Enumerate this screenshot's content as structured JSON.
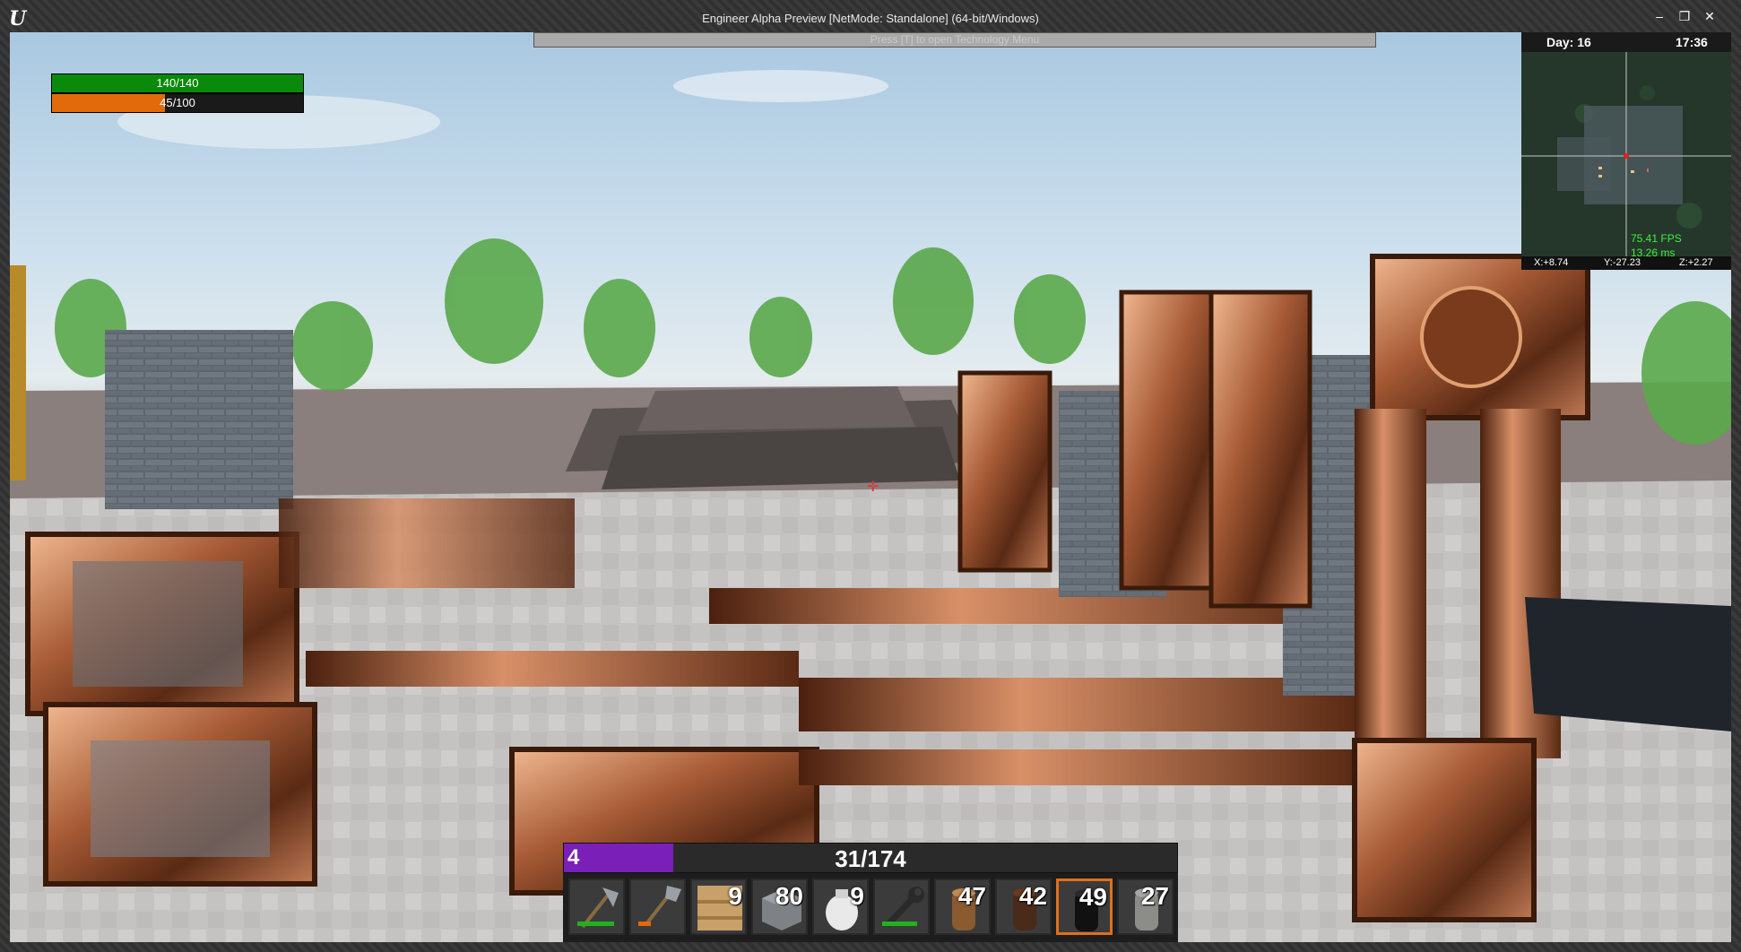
{
  "window": {
    "title": "Engineer Alpha Preview [NetMode: Standalone]  (64-bit/Windows)",
    "logo": "U",
    "minimize_icon": "–",
    "restore_icon": "❐",
    "close_icon": "✕"
  },
  "hud": {
    "tech_hint": "Press [T] to open Technology Menu",
    "health": {
      "label": "140/140",
      "fraction": 1.0,
      "color": "#0a8a0a"
    },
    "stamina": {
      "label": "45/100",
      "fraction": 0.45,
      "color": "#e36a0a"
    },
    "crosshair": "✛"
  },
  "minimap": {
    "day": "Day: 16",
    "time": "17:36",
    "fps": "75.41 FPS",
    "ms": "13.26 ms",
    "x": "X:+8.74",
    "y": "Y:-27.23",
    "z": "Z:+2.27"
  },
  "experience": {
    "level": "4",
    "progress": "31/174",
    "fraction": 0.178,
    "color": "#7a1fb8"
  },
  "hotbar": [
    {
      "name": "axe-icon",
      "qty": "",
      "durability": 0.9,
      "dur_color": "#1fb21f",
      "selected": false
    },
    {
      "name": "shovel-icon",
      "qty": "",
      "durability": 0.3,
      "dur_color": "#e36a0a",
      "selected": false
    },
    {
      "name": "plank-icon",
      "qty": "9",
      "selected": false
    },
    {
      "name": "stone-block-icon",
      "qty": "80",
      "selected": false
    },
    {
      "name": "bag-icon",
      "qty": "9",
      "selected": false
    },
    {
      "name": "wrench-icon",
      "qty": "",
      "durability": 0.85,
      "dur_color": "#1fb21f",
      "selected": false
    },
    {
      "name": "wood-log-icon",
      "qty": "47",
      "selected": false
    },
    {
      "name": "dark-log-icon",
      "qty": "42",
      "selected": false
    },
    {
      "name": "coal-icon",
      "qty": "49",
      "selected": true
    },
    {
      "name": "stone-cylinder-icon",
      "qty": "27",
      "selected": false
    }
  ]
}
